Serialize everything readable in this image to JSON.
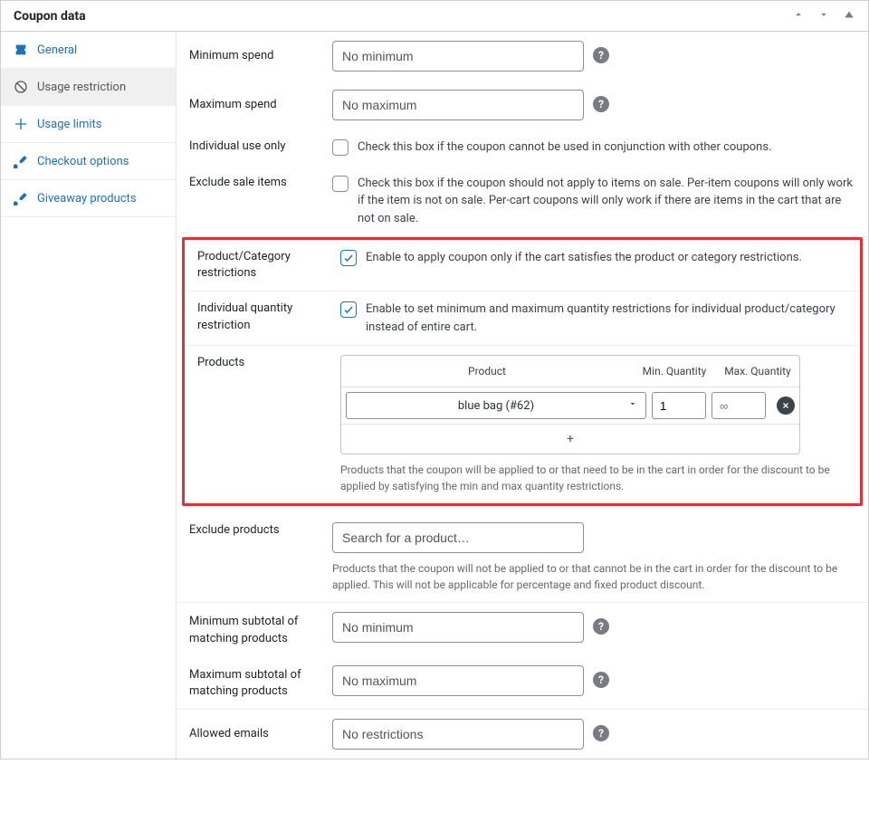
{
  "header": {
    "title": "Coupon data"
  },
  "sidebar": {
    "items": [
      {
        "label": "General"
      },
      {
        "label": "Usage restriction"
      },
      {
        "label": "Usage limits"
      },
      {
        "label": "Checkout options"
      },
      {
        "label": "Giveaway products"
      }
    ]
  },
  "rows": {
    "min_spend": {
      "label": "Minimum spend",
      "placeholder": "No minimum"
    },
    "max_spend": {
      "label": "Maximum spend",
      "placeholder": "No maximum"
    },
    "individual_use": {
      "label": "Individual use only",
      "desc": "Check this box if the coupon cannot be used in conjunction with other coupons."
    },
    "exclude_sale": {
      "label": "Exclude sale items",
      "desc": "Check this box if the coupon should not apply to items on sale. Per-item coupons will only work if the item is not on sale. Per-cart coupons will only work if there are items in the cart that are not on sale."
    },
    "prod_cat_restr": {
      "label": "Product/Category restrictions",
      "desc": "Enable to apply coupon only if the cart satisfies the product or category restrictions."
    },
    "ind_qty_restr": {
      "label": "Individual quantity restriction",
      "desc": "Enable to set minimum and maximum quantity restrictions for individual product/category instead of entire cart."
    },
    "products": {
      "label": "Products",
      "col_product": "Product",
      "col_min": "Min. Quantity",
      "col_max": "Max. Quantity",
      "items": [
        {
          "name": "blue bag (#62)",
          "min": "1",
          "max_placeholder": "∞"
        }
      ],
      "add": "+",
      "desc": "Products that the coupon will be applied to or that need to be in the cart in order for the discount to be applied by satisfying the min and max quantity restrictions."
    },
    "exclude_products": {
      "label": "Exclude products",
      "placeholder": "Search for a product…",
      "desc": "Products that the coupon will not be applied to or that cannot be in the cart in order for the discount to be applied. This will not be applicable for percentage and fixed product discount."
    },
    "min_subtotal": {
      "label": "Minimum subtotal of matching products",
      "placeholder": "No minimum"
    },
    "max_subtotal": {
      "label": "Maximum subtotal of matching products",
      "placeholder": "No maximum"
    },
    "allowed_emails": {
      "label": "Allowed emails",
      "placeholder": "No restrictions"
    }
  }
}
